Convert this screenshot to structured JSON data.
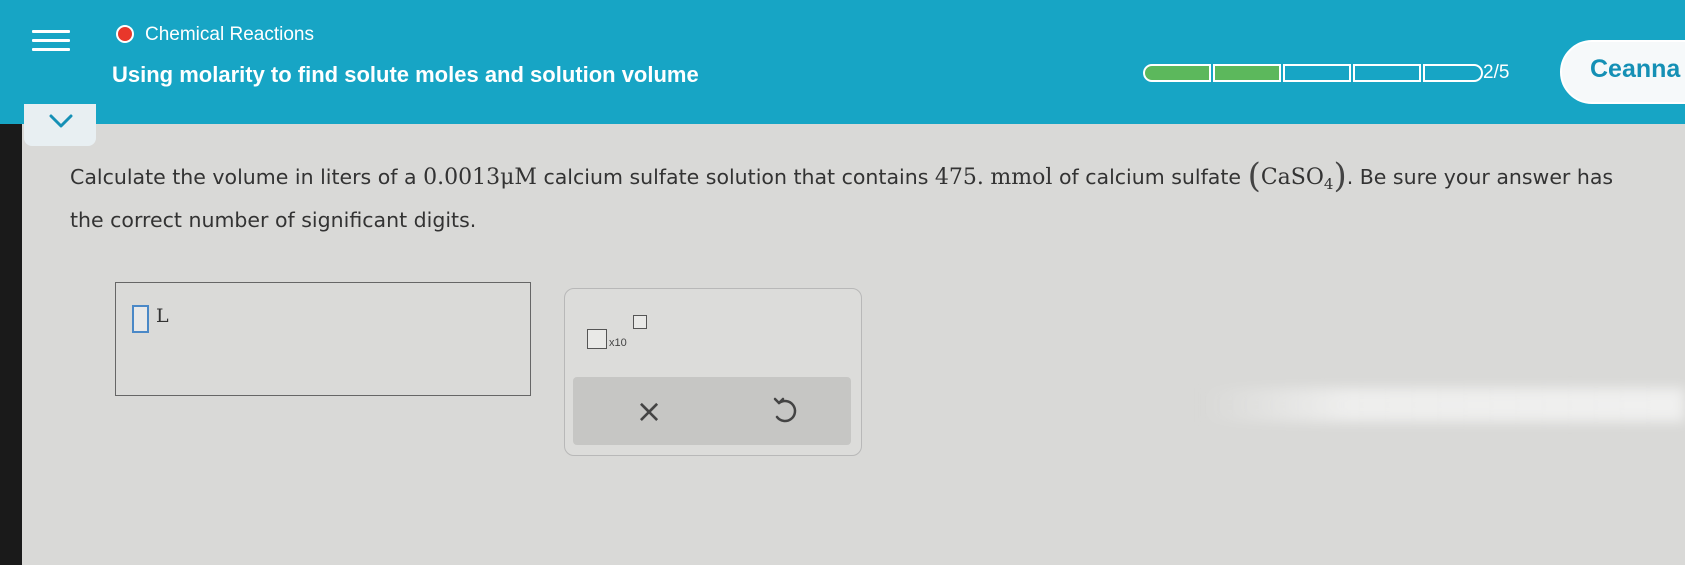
{
  "header": {
    "topic": "Chemical Reactions",
    "title": "Using molarity to find solute moles and solution volume",
    "progress_completed": 2,
    "progress_total": 5,
    "progress_text": "2/5",
    "user_name": "Ceanna",
    "icons": {
      "menu": "hamburger-menu-icon",
      "topic": "red-dot-icon",
      "collapse": "chevron-down-icon"
    },
    "colors": {
      "header_bg": "#17a5c5",
      "progress_done": "#5cb85c",
      "topic_dot": "#e8372b"
    }
  },
  "question": {
    "text_1": "Calculate the volume in liters of a",
    "concentration": "0.0013",
    "concentration_unit": "μM",
    "text_2": "calcium sulfate solution that contains",
    "amount": "475.",
    "amount_unit": "mmol",
    "text_3": "of calcium sulfate",
    "formula_main": "CaSO",
    "formula_sub": "4",
    "text_4": ". Be sure your answer has the correct number of significant digits."
  },
  "answer": {
    "value": "",
    "unit": "L"
  },
  "keypad": {
    "sci_notation_label": "x10",
    "clear_label": "×",
    "icons": {
      "clear": "x-icon",
      "undo": "undo-icon",
      "sci": "scientific-notation-icon"
    }
  }
}
